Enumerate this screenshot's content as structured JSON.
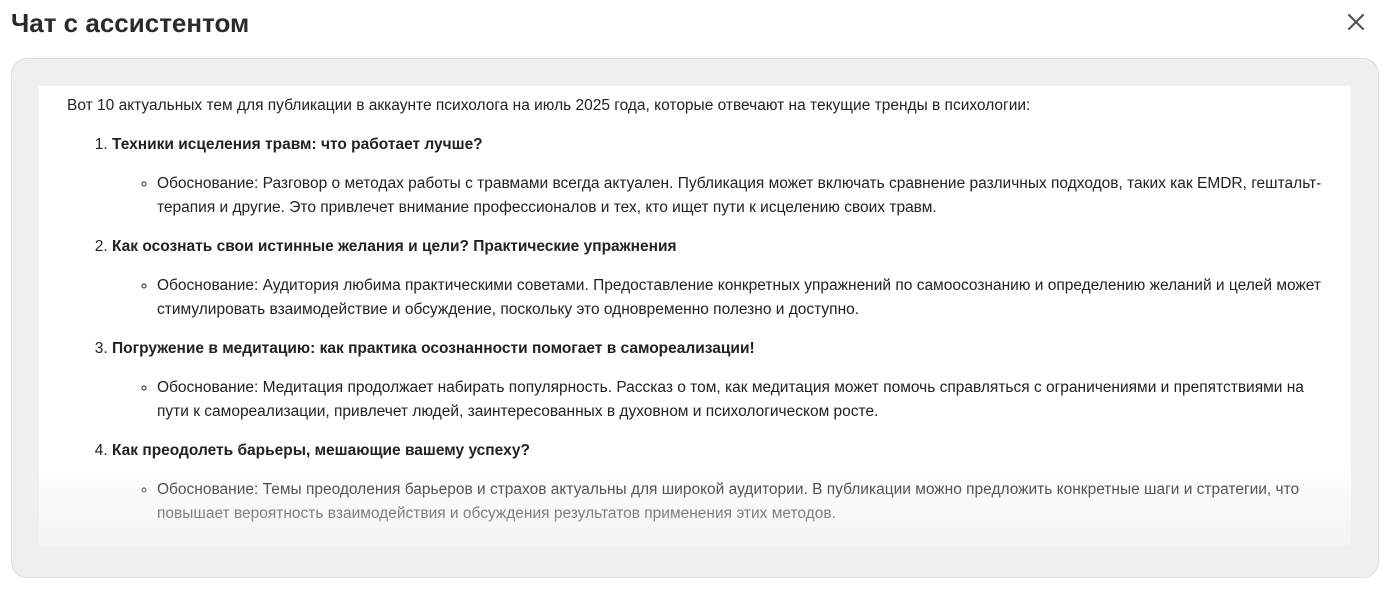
{
  "dialog": {
    "title": "Чат с ассистентом",
    "close_icon": "close-icon"
  },
  "message": {
    "intro": "Вот 10 актуальных тем для публикации в аккаунте психолога на июль 2025 года, которые отвечают на текущие тренды в психологии:",
    "topics": [
      {
        "title": "Техники исцеления травм: что работает лучше?",
        "reason": "Обоснование: Разговор о методах работы с травмами всегда актуален. Публикация может включать сравнение различных подходов, таких как EMDR, гештальт-терапия и другие. Это привлечет внимание профессионалов и тех, кто ищет пути к исцелению своих травм."
      },
      {
        "title": "Как осознать свои истинные желания и цели? Практические упражнения",
        "reason": "Обоснование: Аудитория любима практическими советами. Предоставление конкретных упражнений по самоосознанию и определению желаний и целей может стимулировать взаимодействие и обсуждение, поскольку это одновременно полезно и доступно."
      },
      {
        "title": "Погружение в медитацию: как практика осознанности помогает в самореализации!",
        "reason": "Обоснование: Медитация продолжает набирать популярность. Рассказ о том, как медитация может помочь справляться с ограничениями и препятствиями на пути к самореализации, привлечет людей, заинтересованных в духовном и психологическом росте."
      },
      {
        "title": "Как преодолеть барьеры, мешающие вашему успеху?",
        "reason": "Обоснование: Темы преодоления барьеров и страхов актуальны для широкой аудитории. В публикации можно предложить конкретные шаги и стратегии, что повышает вероятность взаимодействия и обсуждения результатов применения этих методов."
      }
    ]
  },
  "colors": {
    "title": "#2a2a2a",
    "text": "#222222",
    "panel_background": "#efefef",
    "message_background": "#ffffff"
  }
}
